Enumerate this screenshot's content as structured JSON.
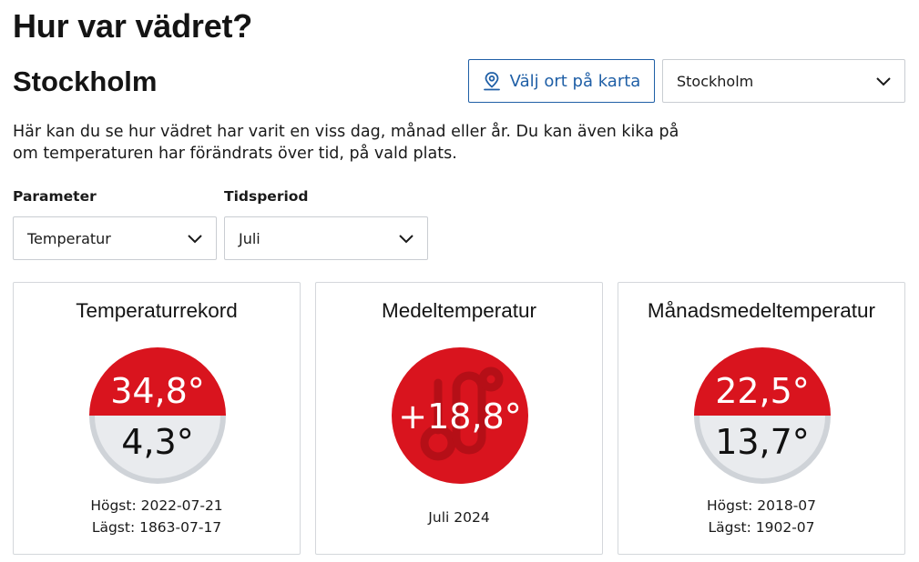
{
  "header": {
    "title": "Hur var vädret?",
    "city": "Stockholm"
  },
  "map_button": {
    "label": "Välj ort på karta",
    "icon": "map-pin-icon"
  },
  "city_select": {
    "value": "Stockholm"
  },
  "intro": "Här kan du se hur vädret har varit en viss dag, månad eller år. Du kan även kika på om temperaturen har förändrats över tid, på vald plats.",
  "filters": {
    "parameter": {
      "label": "Parameter",
      "value": "Temperatur"
    },
    "period": {
      "label": "Tidsperiod",
      "value": "Juli"
    }
  },
  "cards": [
    {
      "title": "Temperaturrekord",
      "high": "34,8°",
      "low": "4,3°",
      "high_line": "Högst: 2022-07-21",
      "low_line": "Lägst: 1863-07-17"
    },
    {
      "title": "Medeltemperatur",
      "value": "+18,8°",
      "caption": "Juli 2024",
      "icon": "thermometer-icon"
    },
    {
      "title": "Månadsmedeltemperatur",
      "high": "22,5°",
      "low": "13,7°",
      "high_line": "Högst: 2018-07",
      "low_line": "Lägst: 1902-07"
    }
  ],
  "colors": {
    "accent": "#1f5fa6",
    "warm": "#d9141e",
    "warm_dark": "#b50f17",
    "cool": "#e9ebee",
    "cool_ring": "#cfd3d8"
  }
}
